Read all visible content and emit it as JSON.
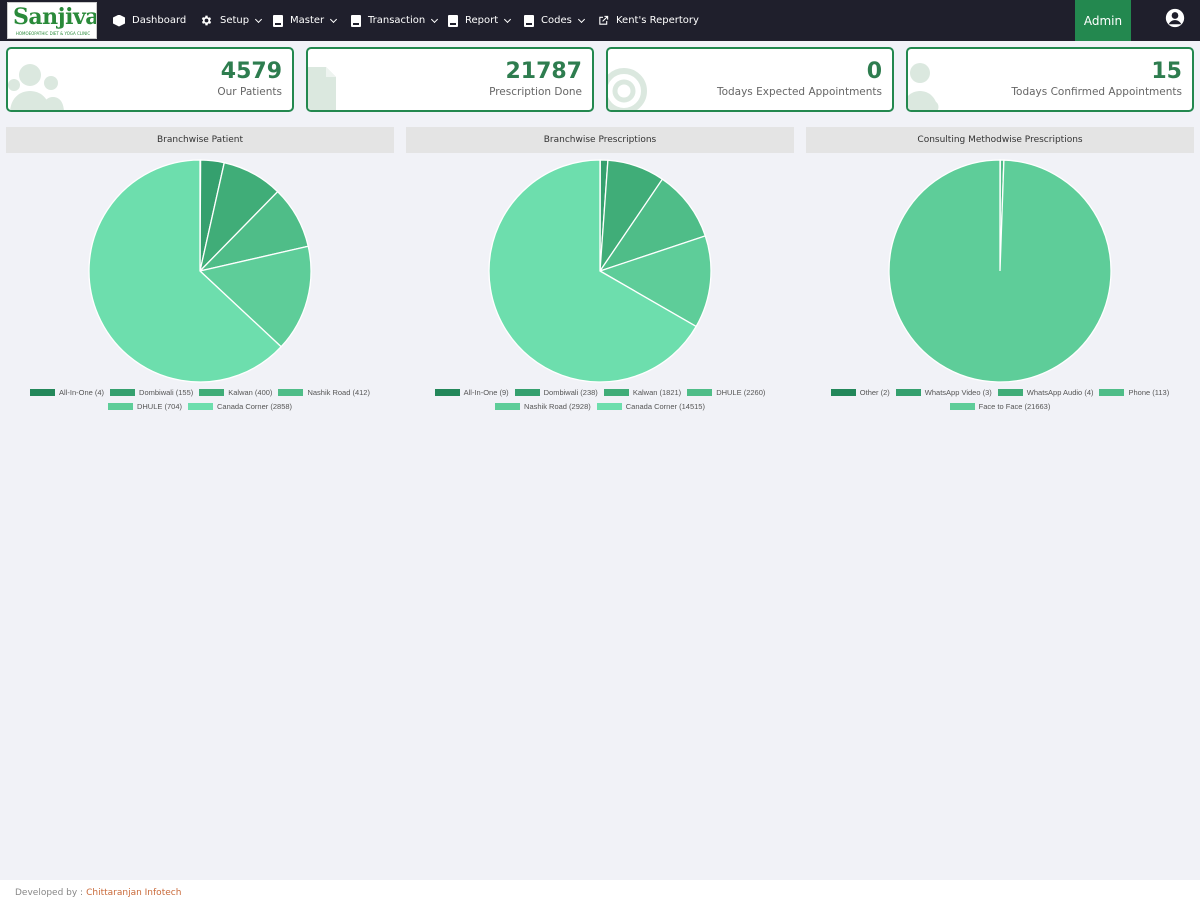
{
  "brand": {
    "name": "Sanjivani",
    "tagline": "HOMOEOPATHIC DIET & YOGA CLINIC"
  },
  "nav": {
    "dashboard": "Dashboard",
    "setup": "Setup",
    "master": "Master",
    "transaction": "Transaction",
    "report": "Report",
    "codes": "Codes",
    "repertory": "Kent's Repertory",
    "admin": "Admin"
  },
  "stats": [
    {
      "value": "4579",
      "label": "Our Patients"
    },
    {
      "value": "21787",
      "label": "Prescription Done"
    },
    {
      "value": "0",
      "label": "Todays Expected Appointments"
    },
    {
      "value": "15",
      "label": "Todays Confirmed Appointments"
    }
  ],
  "colors": {
    "navbar": "#1f1f2c",
    "accent": "#23884f",
    "stat_number": "#2e7d4f",
    "footer_link": "#c96a3a"
  },
  "chart_data": [
    {
      "type": "pie",
      "title": "Branchwise Patient",
      "categories": [
        "All-In-One",
        "Dombiwali",
        "Kalwan",
        "Nashik Road",
        "DHULE",
        "Canada Corner"
      ],
      "values": [
        4,
        155,
        400,
        412,
        704,
        2858
      ],
      "legend_labels": [
        "All-In-One (4)",
        "Dombiwali (155)",
        "Kalwan (400)",
        "Nashik Road (412)",
        "DHULE (704)",
        "Canada Corner (2858)"
      ],
      "colors": [
        "#23875a",
        "#35a06e",
        "#40ad78",
        "#4fbd88",
        "#5ecd99",
        "#6ddead"
      ],
      "legend": "bottom"
    },
    {
      "type": "pie",
      "title": "Branchwise Prescriptions",
      "categories": [
        "All-In-One",
        "Dombiwali",
        "Kalwan",
        "DHULE",
        "Nashik Road",
        "Canada Corner"
      ],
      "values": [
        9,
        238,
        1821,
        2260,
        2928,
        14515
      ],
      "legend_labels": [
        "All-In-One (9)",
        "Dombiwali (238)",
        "Kalwan (1821)",
        "DHULE (2260)",
        "Nashik Road (2928)",
        "Canada Corner (14515)"
      ],
      "colors": [
        "#23875a",
        "#35a06e",
        "#40ad78",
        "#4fbd88",
        "#5ecd99",
        "#6ddead"
      ],
      "legend": "bottom"
    },
    {
      "type": "pie",
      "title": "Consulting Methodwise Prescriptions",
      "categories": [
        "Other",
        "WhatsApp Video",
        "WhatsApp Audio",
        "Phone",
        "Face to Face"
      ],
      "values": [
        2,
        3,
        4,
        113,
        21663
      ],
      "legend_labels": [
        "Other (2)",
        "WhatsApp Video (3)",
        "WhatsApp Audio (4)",
        "Phone (113)",
        "Face to Face (21663)"
      ],
      "colors": [
        "#23875a",
        "#35a06e",
        "#40ad78",
        "#4fbd88",
        "#5ecd99"
      ],
      "legend": "bottom"
    }
  ],
  "footer": {
    "prefix": "Developed by :",
    "company": "Chittaranjan Infotech"
  }
}
